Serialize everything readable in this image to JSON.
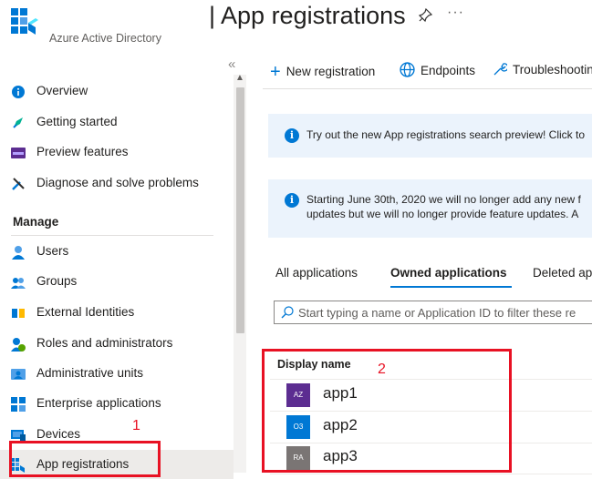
{
  "header": {
    "title": "| App registrations",
    "subtitle": "Azure Active Directory",
    "more": "···"
  },
  "sidebar": {
    "collapse_glyph": "«",
    "items_top": [
      {
        "label": "Overview",
        "icon": "info-icon"
      },
      {
        "label": "Getting started",
        "icon": "rocket-icon"
      },
      {
        "label": "Preview features",
        "icon": "preview-icon"
      },
      {
        "label": "Diagnose and solve problems",
        "icon": "wrench-icon"
      }
    ],
    "manage_heading": "Manage",
    "items_manage": [
      {
        "label": "Users",
        "icon": "user-icon"
      },
      {
        "label": "Groups",
        "icon": "groups-icon"
      },
      {
        "label": "External Identities",
        "icon": "external-identities-icon"
      },
      {
        "label": "Roles and administrators",
        "icon": "roles-icon"
      },
      {
        "label": "Administrative units",
        "icon": "admin-units-icon"
      },
      {
        "label": "Enterprise applications",
        "icon": "enterprise-apps-icon"
      },
      {
        "label": "Devices",
        "icon": "devices-icon"
      },
      {
        "label": "App registrations",
        "icon": "app-registrations-icon",
        "active": true
      }
    ]
  },
  "toolbar": {
    "new_registration": "New registration",
    "endpoints": "Endpoints",
    "troubleshooting": "Troubleshootin"
  },
  "banners": {
    "search_preview": "Try out the new App registrations search preview! Click to",
    "notice_line1": "Starting June 30th, 2020 we will no longer add any new f",
    "notice_line2": "updates but we will no longer provide feature updates. A"
  },
  "tabs": [
    {
      "label": "All applications",
      "active": false
    },
    {
      "label": "Owned applications",
      "active": true
    },
    {
      "label": "Deleted ap",
      "active": false
    }
  ],
  "filter": {
    "placeholder": "Start typing a name or Application ID to filter these re"
  },
  "table": {
    "column_header": "Display name",
    "rows": [
      {
        "initials": "AZ",
        "name": "app1",
        "color": "#5c2d91"
      },
      {
        "initials": "O3",
        "name": "app2",
        "color": "#0078d4"
      },
      {
        "initials": "RA",
        "name": "app3",
        "color": "#7a7574"
      }
    ]
  },
  "annotations": {
    "label_1": "1",
    "label_2": "2",
    "color": "#e81123"
  },
  "colors": {
    "accent": "#0078d4",
    "banner_bg": "#ebf3fc",
    "active_nav_bg": "#edebe9"
  }
}
